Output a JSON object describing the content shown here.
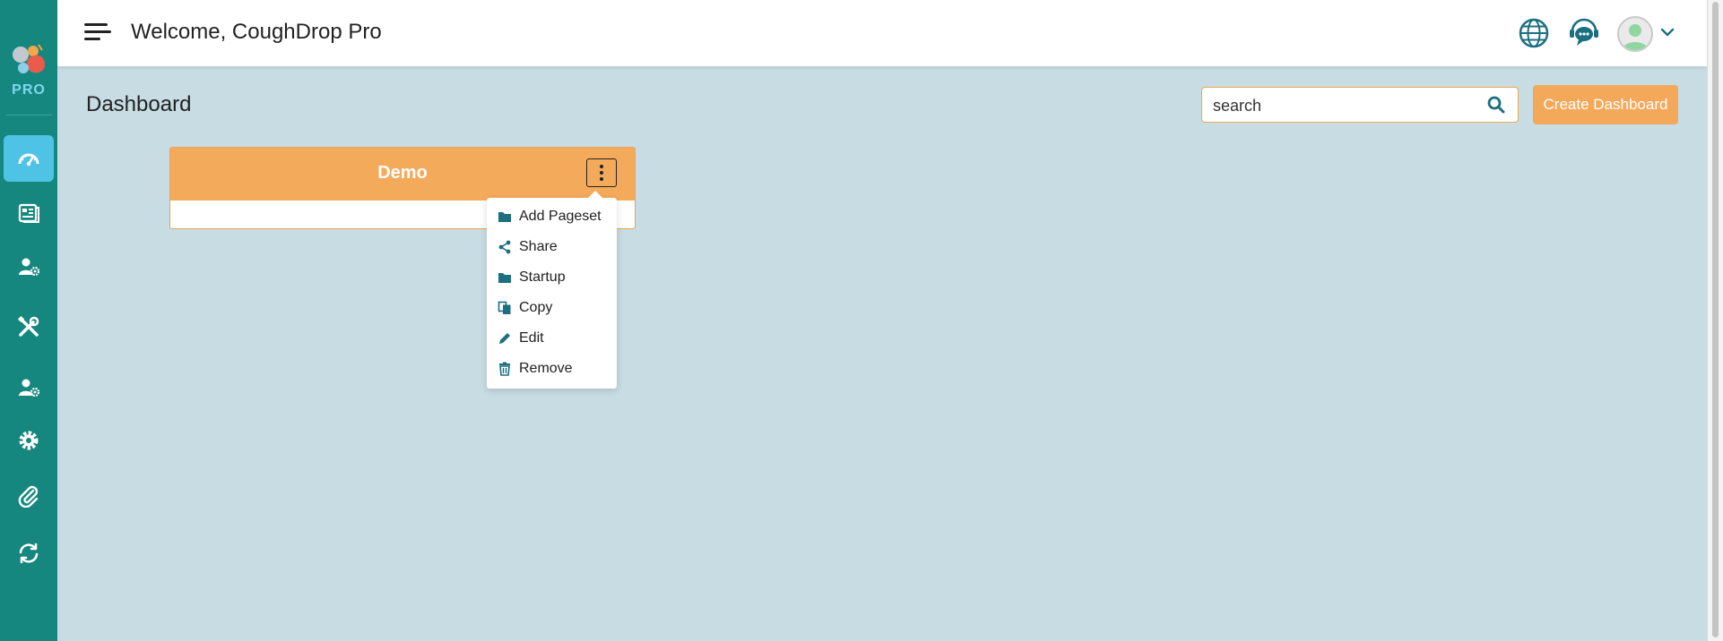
{
  "sidebar": {
    "logo_text": "PRO",
    "items": [
      {
        "name": "dashboard",
        "icon": "speedometer-icon",
        "active": true
      },
      {
        "name": "pagesets",
        "icon": "pages-icon",
        "active": false
      },
      {
        "name": "users",
        "icon": "user-gear-icon",
        "active": false
      },
      {
        "name": "tools",
        "icon": "tools-icon",
        "active": false
      },
      {
        "name": "account",
        "icon": "user-gear-icon",
        "active": false
      },
      {
        "name": "settings",
        "icon": "gear-icon",
        "active": false
      },
      {
        "name": "attachments",
        "icon": "paperclip-icon",
        "active": false
      },
      {
        "name": "sync",
        "icon": "sync-icon",
        "active": false
      }
    ]
  },
  "header": {
    "welcome": "Welcome, CoughDrop Pro",
    "icons": [
      "globe-icon",
      "support-chat-icon",
      "user-avatar",
      "chevron-down-icon"
    ]
  },
  "main": {
    "page_title": "Dashboard",
    "search": {
      "placeholder": "search",
      "value": ""
    },
    "create_label": "Create Dashboard",
    "card": {
      "title": "Demo"
    },
    "menu": {
      "items": [
        {
          "label": "Add Pageset",
          "icon": "folder-icon"
        },
        {
          "label": "Share",
          "icon": "share-icon"
        },
        {
          "label": "Startup",
          "icon": "folder-icon"
        },
        {
          "label": "Copy",
          "icon": "copy-icon"
        },
        {
          "label": "Edit",
          "icon": "pencil-icon"
        },
        {
          "label": "Remove",
          "icon": "trash-icon"
        }
      ]
    }
  },
  "colors": {
    "sidebar": "#16877e",
    "accent_orange": "#f4aa5b",
    "background": "#c7dce3",
    "icon_teal": "#1b6f80"
  }
}
